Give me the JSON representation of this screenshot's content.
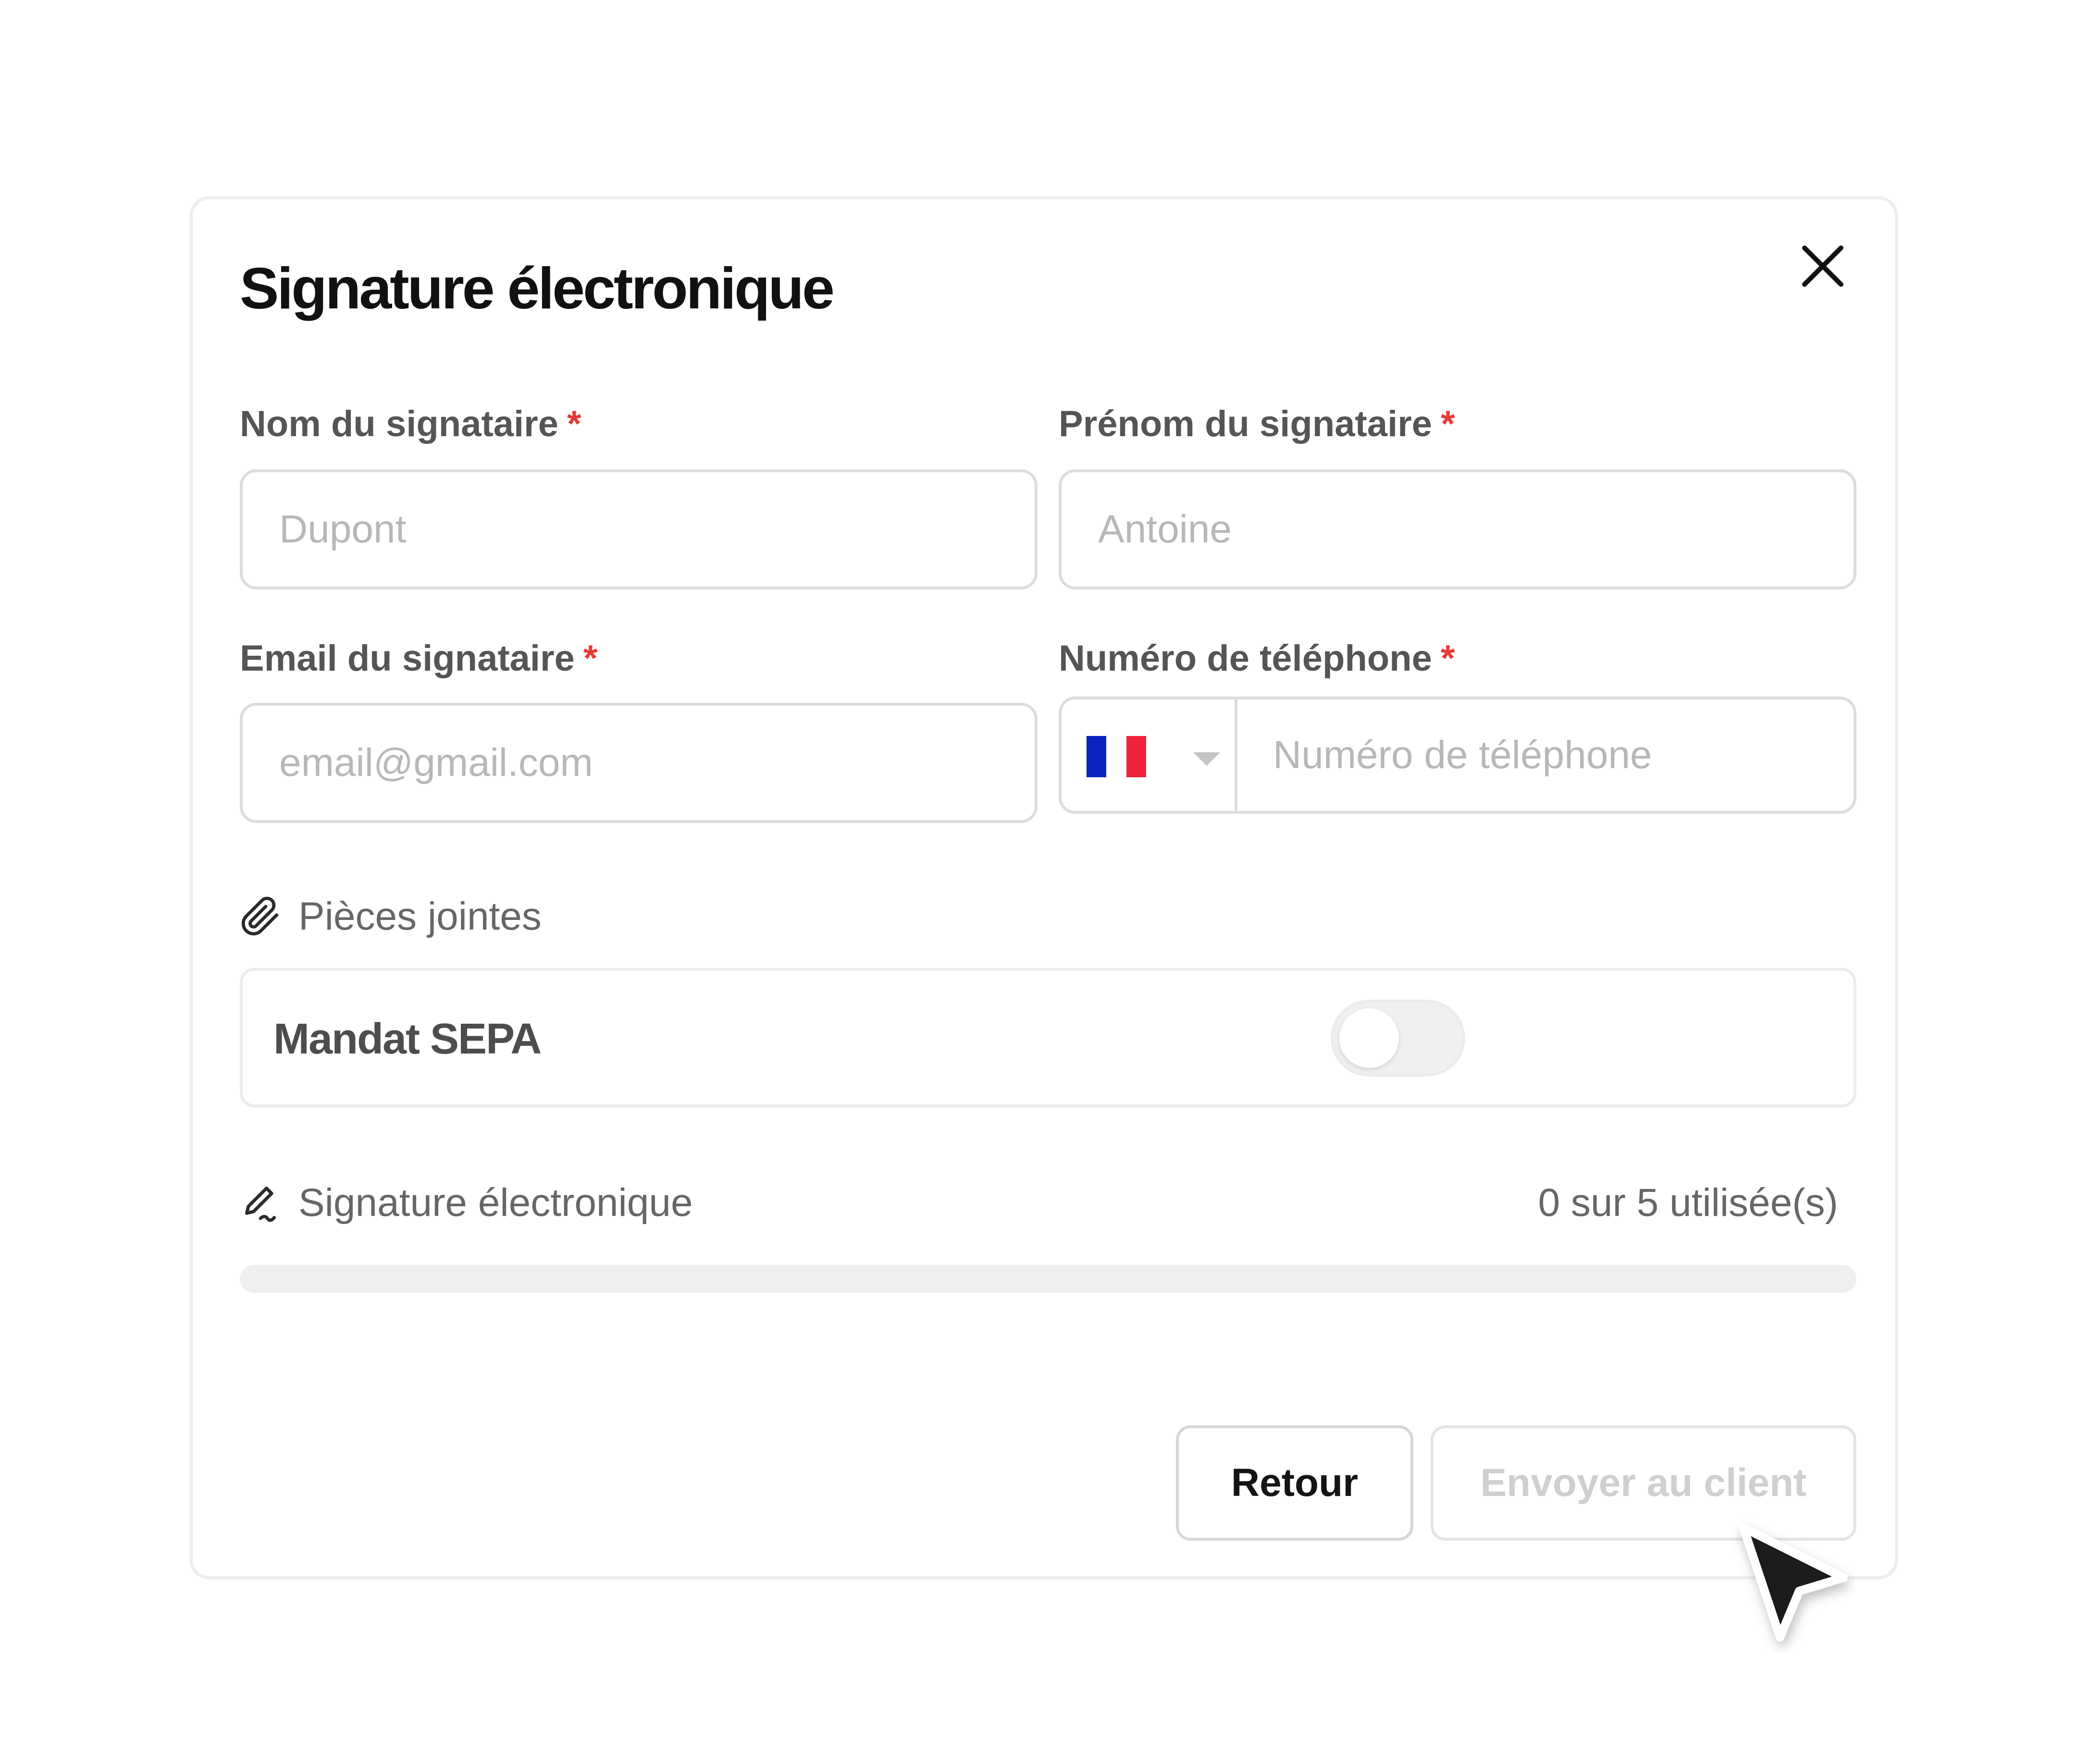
{
  "dialog": {
    "title": "Signature électronique",
    "close_icon": "close-icon"
  },
  "form": {
    "last_name": {
      "label": "Nom du signataire",
      "required_mark": "*",
      "placeholder": "Dupont",
      "value": ""
    },
    "first_name": {
      "label": "Prénom du signataire",
      "required_mark": "*",
      "placeholder": "Antoine",
      "value": ""
    },
    "email": {
      "label": "Email du signataire",
      "required_mark": "*",
      "placeholder": "email@gmail.com",
      "value": ""
    },
    "phone": {
      "label": "Numéro de téléphone",
      "required_mark": "*",
      "placeholder": "Numéro de téléphone",
      "value": "",
      "country_flag": "flag-france-icon",
      "flag_colors": [
        "#0a24c2",
        "#ffffff",
        "#ef233c"
      ]
    }
  },
  "attachments": {
    "icon": "paperclip-icon",
    "label": "Pièces jointes",
    "items": [
      {
        "label": "Mandat SEPA",
        "toggle_on": false
      }
    ]
  },
  "signature_usage": {
    "icon": "pen-signature-icon",
    "label": "Signature électronique",
    "usage_text": "0 sur 5 utilisée(s)",
    "used": 0,
    "total": 5
  },
  "actions": {
    "back_label": "Retour",
    "send_label": "Envoyer au client",
    "send_disabled": true
  },
  "colors": {
    "required": "#e53935",
    "label_text": "#555555",
    "placeholder": "#b7b7b7",
    "disabled_text": "#cfcfcf"
  },
  "pointer": "mouse-cursor-icon"
}
